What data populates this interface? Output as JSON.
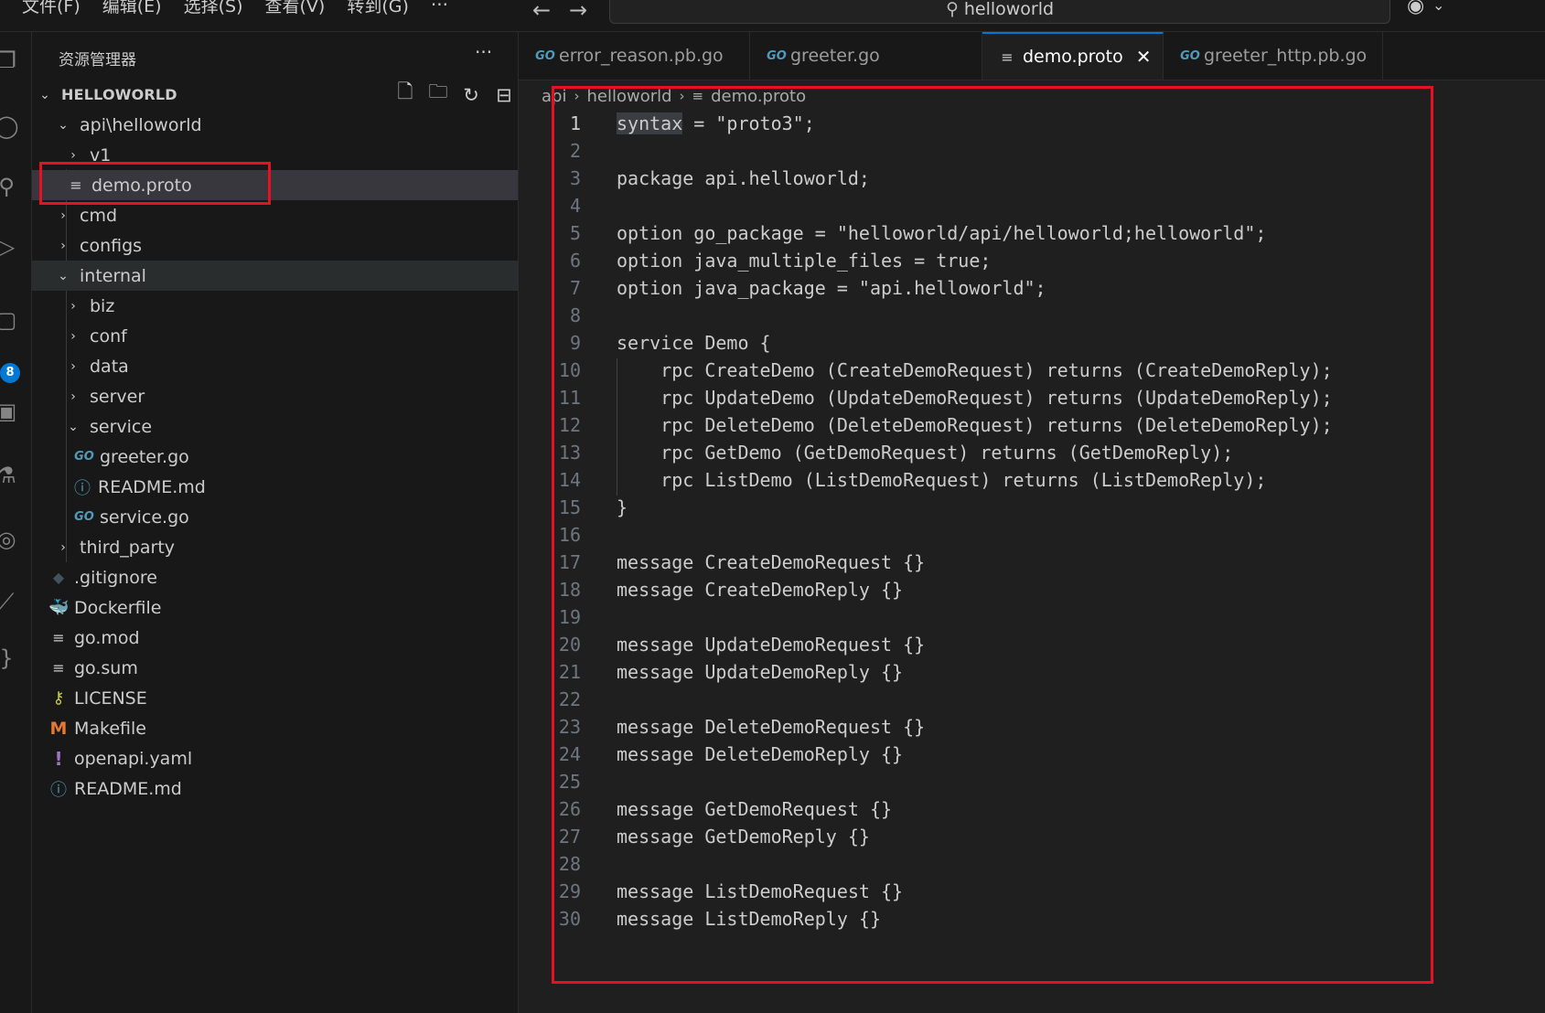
{
  "menu": {
    "items": [
      "文件(F)",
      "编辑(E)",
      "选择(S)",
      "查看(V)",
      "转到(G)"
    ],
    "more": "···"
  },
  "titlebar": {
    "back": "←",
    "forward": "→",
    "search_text": "helloworld"
  },
  "activity": {
    "badge": "8"
  },
  "sidebar": {
    "title": "资源管理器",
    "more": "···",
    "root": "HELLOWORLD",
    "tree": [
      {
        "label": "api\\helloworld",
        "type": "folder-open",
        "icon": "chevron-down-icon"
      },
      {
        "label": "v1",
        "type": "folder",
        "icon": "chevron-right-icon"
      },
      {
        "label": "demo.proto",
        "type": "file-proto",
        "icon": "proto-file-icon"
      },
      {
        "label": "cmd",
        "type": "folder",
        "icon": "chevron-right-icon"
      },
      {
        "label": "configs",
        "type": "folder",
        "icon": "chevron-right-icon"
      },
      {
        "label": "internal",
        "type": "folder-open",
        "icon": "chevron-down-icon"
      },
      {
        "label": "biz",
        "type": "folder",
        "icon": "chevron-right-icon"
      },
      {
        "label": "conf",
        "type": "folder",
        "icon": "chevron-right-icon"
      },
      {
        "label": "data",
        "type": "folder",
        "icon": "chevron-right-icon"
      },
      {
        "label": "server",
        "type": "folder",
        "icon": "chevron-right-icon"
      },
      {
        "label": "service",
        "type": "folder-open",
        "icon": "chevron-down-icon"
      },
      {
        "label": "greeter.go",
        "type": "file-go",
        "icon": "go-file-icon"
      },
      {
        "label": "README.md",
        "type": "file-info",
        "icon": "info-icon"
      },
      {
        "label": "service.go",
        "type": "file-go",
        "icon": "go-file-icon"
      },
      {
        "label": "third_party",
        "type": "folder",
        "icon": "chevron-right-icon"
      },
      {
        "label": ".gitignore",
        "type": "file-git",
        "icon": "git-icon"
      },
      {
        "label": "Dockerfile",
        "type": "file-docker",
        "icon": "docker-icon"
      },
      {
        "label": "go.mod",
        "type": "file-text",
        "icon": "text-file-icon"
      },
      {
        "label": "go.sum",
        "type": "file-text",
        "icon": "text-file-icon"
      },
      {
        "label": "LICENSE",
        "type": "file-license",
        "icon": "license-icon"
      },
      {
        "label": "Makefile",
        "type": "file-make",
        "icon": "makefile-icon"
      },
      {
        "label": "openapi.yaml",
        "type": "file-yaml",
        "icon": "yaml-icon"
      },
      {
        "label": "README.md",
        "type": "file-info",
        "icon": "info-icon"
      }
    ]
  },
  "tabs": [
    {
      "label": "error_reason.pb.go",
      "icon": "go-file-icon",
      "active": false
    },
    {
      "label": "greeter.go",
      "icon": "go-file-icon",
      "active": false
    },
    {
      "label": "demo.proto",
      "icon": "proto-file-icon",
      "active": true,
      "close": "✕"
    },
    {
      "label": "greeter_http.pb.go",
      "icon": "go-file-icon",
      "active": false
    }
  ],
  "breadcrumb": [
    "api",
    "helloworld",
    "demo.proto"
  ],
  "editor": {
    "lines": [
      "syntax = \"proto3\";",
      "",
      "package api.helloworld;",
      "",
      "option go_package = \"helloworld/api/helloworld;helloworld\";",
      "option java_multiple_files = true;",
      "option java_package = \"api.helloworld\";",
      "",
      "service Demo {",
      "    rpc CreateDemo (CreateDemoRequest) returns (CreateDemoReply);",
      "    rpc UpdateDemo (UpdateDemoRequest) returns (UpdateDemoReply);",
      "    rpc DeleteDemo (DeleteDemoRequest) returns (DeleteDemoReply);",
      "    rpc GetDemo (GetDemoRequest) returns (GetDemoReply);",
      "    rpc ListDemo (ListDemoRequest) returns (ListDemoReply);",
      "}",
      "",
      "message CreateDemoRequest {}",
      "message CreateDemoReply {}",
      "",
      "message UpdateDemoRequest {}",
      "message UpdateDemoReply {}",
      "",
      "message DeleteDemoRequest {}",
      "message DeleteDemoReply {}",
      "",
      "message GetDemoRequest {}",
      "message GetDemoReply {}",
      "",
      "message ListDemoRequest {}",
      "message ListDemoReply {}"
    ],
    "current_line": 1
  },
  "colors": {
    "accent": "#0078d4",
    "highlight_box": "#e81123",
    "go_icon": "#519aba"
  }
}
